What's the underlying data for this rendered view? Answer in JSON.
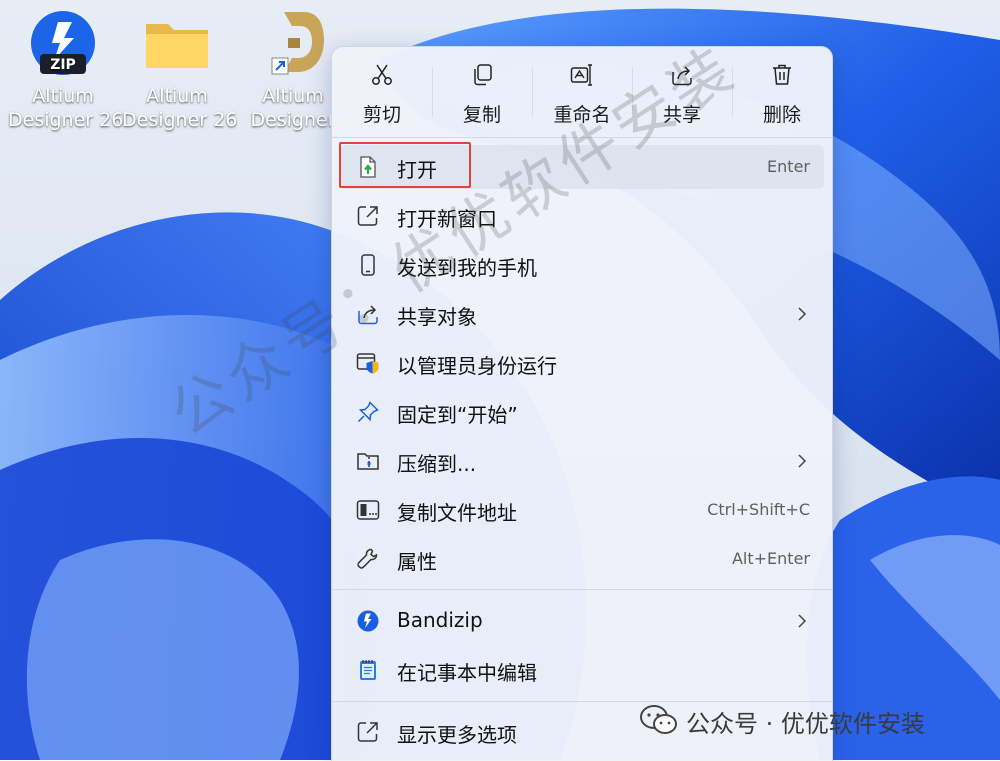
{
  "desktop": {
    "icons": [
      {
        "line1": "Altium",
        "line2": "Designer 26",
        "icon": "zip-archive-icon"
      },
      {
        "line1": "Altium",
        "line2": "Designer 26",
        "icon": "folder-icon"
      },
      {
        "line1": "Altium",
        "line2": "Designer",
        "icon": "altium-shortcut-icon"
      }
    ]
  },
  "context_menu": {
    "toolbar": [
      {
        "label": "剪切",
        "icon": "scissors-icon"
      },
      {
        "label": "复制",
        "icon": "copy-icon"
      },
      {
        "label": "重命名",
        "icon": "rename-icon"
      },
      {
        "label": "共享",
        "icon": "share-icon"
      },
      {
        "label": "删除",
        "icon": "trash-icon"
      }
    ],
    "items": [
      {
        "label": "打开",
        "shortcut": "Enter",
        "icon": "open-file-icon"
      },
      {
        "label": "打开新窗口",
        "icon": "open-new-window-icon"
      },
      {
        "label": "发送到我的手机",
        "icon": "phone-icon"
      },
      {
        "label": "共享对象",
        "icon": "share-object-icon",
        "submenu": true
      },
      {
        "label": "以管理员身份运行",
        "icon": "admin-shield-icon"
      },
      {
        "label": "固定到“开始”",
        "icon": "pin-icon"
      },
      {
        "label": "压缩到...",
        "icon": "compress-folder-icon",
        "submenu": true
      },
      {
        "label": "复制文件地址",
        "shortcut": "Ctrl+Shift+C",
        "icon": "copy-path-icon"
      },
      {
        "label": "属性",
        "shortcut": "Alt+Enter",
        "icon": "wrench-icon"
      },
      {
        "label": "Bandizip",
        "icon": "bandizip-icon",
        "submenu": true
      },
      {
        "label": "在记事本中编辑",
        "icon": "notepad-icon"
      },
      {
        "label": "显示更多选项",
        "icon": "more-options-icon"
      }
    ]
  },
  "watermark": {
    "diagonal": "公众号：优优软件安装",
    "footer": "公众号 · 优优软件安装"
  },
  "colors": {
    "accent_blue": "#1a5fe0",
    "highlight_box": "#e0443b",
    "menu_background": "#eff2fa"
  }
}
